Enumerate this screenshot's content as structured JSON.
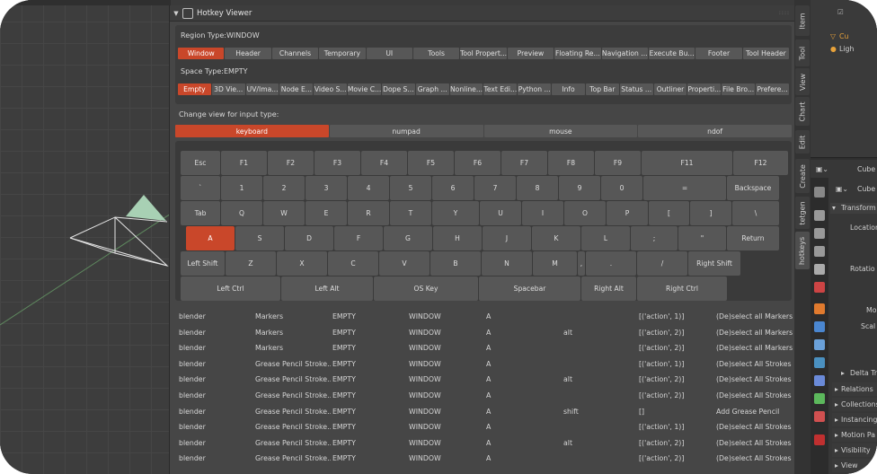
{
  "panel": {
    "title": "Hotkey Viewer",
    "collapse_icon": "triangle-down-icon",
    "grip": "::::"
  },
  "region": {
    "label": "Region Type:WINDOW",
    "buttons": [
      "Window",
      "Header",
      "Channels",
      "Temporary",
      "UI",
      "Tools",
      "Tool Propert...",
      "Preview",
      "Floating Re...",
      "Navigation ...",
      "Execute Bu...",
      "Footer",
      "Tool Header"
    ],
    "active": "Window"
  },
  "space": {
    "label": "Space Type:EMPTY",
    "buttons": [
      "Empty",
      "3D Vie...",
      "UV/Ima...",
      "Node E...",
      "Video S...",
      "Movie C...",
      "Dope S...",
      "Graph ...",
      "Nonline...",
      "Text Edi...",
      "Python ...",
      "Info",
      "Top Bar",
      "Status ...",
      "Outliner",
      "Properti...",
      "File Bro...",
      "Prefere..."
    ],
    "active": "Empty"
  },
  "input": {
    "label": "Change view for input type:",
    "buttons": [
      "keyboard",
      "numpad",
      "mouse",
      "ndof"
    ],
    "active": "keyboard"
  },
  "keyboard": {
    "rows": [
      [
        "Esc",
        "F1",
        "F2",
        "F3",
        "F4",
        "F5",
        "F6",
        "F7",
        "F8",
        "F9",
        "F11",
        "F12"
      ],
      [
        "`",
        "1",
        "2",
        "3",
        "4",
        "5",
        "6",
        "7",
        "8",
        "9",
        "0",
        "=",
        "Backspace"
      ],
      [
        "Tab",
        "Q",
        "W",
        "E",
        "R",
        "T",
        "Y",
        "U",
        "I",
        "O",
        "P",
        "[",
        "]",
        "\\"
      ],
      [
        "A",
        "S",
        "D",
        "F",
        "G",
        "H",
        "J",
        "K",
        "L",
        ";",
        "\"",
        "Return"
      ],
      [
        "Left Shift",
        "Z",
        "X",
        "C",
        "V",
        "B",
        "N",
        "M",
        ",",
        ".",
        "/",
        "Right Shift"
      ],
      [
        "Left Ctrl",
        "Left Alt",
        "OS Key",
        "Spacebar",
        "Right Alt",
        "Right Ctrl"
      ]
    ],
    "active_key": "A"
  },
  "rows": [
    [
      "blender",
      "Markers",
      "EMPTY",
      "WINDOW",
      "A",
      "",
      "[('action', 1)]",
      "(De)select all Markers"
    ],
    [
      "blender",
      "Markers",
      "EMPTY",
      "WINDOW",
      "A",
      "alt",
      "[('action', 2)]",
      "(De)select all Markers"
    ],
    [
      "blender",
      "Markers",
      "EMPTY",
      "WINDOW",
      "A",
      "",
      "[('action', 2)]",
      "(De)select all Markers"
    ],
    [
      "blender",
      "Grease Pencil Stroke...",
      "EMPTY",
      "WINDOW",
      "A",
      "",
      "[('action', 1)]",
      "(De)select All Strokes"
    ],
    [
      "blender",
      "Grease Pencil Stroke...",
      "EMPTY",
      "WINDOW",
      "A",
      "alt",
      "[('action', 2)]",
      "(De)select All Strokes"
    ],
    [
      "blender",
      "Grease Pencil Stroke...",
      "EMPTY",
      "WINDOW",
      "A",
      "",
      "[('action', 2)]",
      "(De)select All Strokes"
    ],
    [
      "blender",
      "Grease Pencil Stroke...",
      "EMPTY",
      "WINDOW",
      "A",
      "shift",
      "[]",
      "Add Grease Pencil"
    ],
    [
      "blender",
      "Grease Pencil Stroke...",
      "EMPTY",
      "WINDOW",
      "A",
      "",
      "[('action', 1)]",
      "(De)select All Strokes"
    ],
    [
      "blender",
      "Grease Pencil Stroke...",
      "EMPTY",
      "WINDOW",
      "A",
      "alt",
      "[('action', 2)]",
      "(De)select All Strokes"
    ],
    [
      "blender",
      "Grease Pencil Stroke...",
      "EMPTY",
      "WINDOW",
      "A",
      "",
      "[('action', 2)]",
      "(De)select All Strokes"
    ]
  ],
  "sidebar_tabs": [
    "Item",
    "Tool",
    "View",
    "Chart",
    "Edit",
    "Create",
    "tetgen",
    "hotkeys"
  ],
  "sidebar_active": "hotkeys",
  "outliner": {
    "items": [
      "Cu",
      "Ligh"
    ]
  },
  "properties": {
    "object_name": "Cube",
    "mesh_name": "Cube",
    "section": "Transform",
    "fields": [
      "Location",
      "Rotatio",
      "Mo",
      "Scal"
    ],
    "subsections": [
      "Delta Tr",
      "Relations",
      "Collections",
      "Instancing",
      "Motion Pa",
      "Visibility",
      "View"
    ]
  },
  "colors": {
    "accent": "#c9472a",
    "bg": "#464646",
    "button": "#575757"
  }
}
